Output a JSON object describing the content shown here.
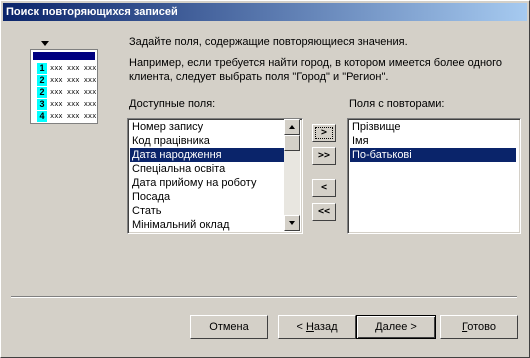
{
  "window": {
    "title": "Поиск повторяющихся записей"
  },
  "illustration": {
    "row_numbers": [
      "1",
      "2",
      "3",
      "4"
    ],
    "cell_pattern": "xxx xxx xxx"
  },
  "intro": {
    "line1": "Задайте поля, содержащие повторяющиеся значения.",
    "line2": "Например, если требуется найти город, в котором имеется более одного",
    "line3": "клиента, следует выбрать поля \"Город\" и \"Регион\"."
  },
  "available": {
    "label": "Доступные поля:",
    "items": [
      "Номер запису",
      "Код працівника",
      "Дата народження",
      "Спеціальна освіта",
      "Дата прийому на роботу",
      "Посада",
      "Стать",
      "Мінімальний оклад"
    ],
    "selected_index": 2
  },
  "selected": {
    "label": "Поля с повторами:",
    "items": [
      "Прізвище",
      "Імя",
      "По-батькові"
    ],
    "selected_index": 2
  },
  "move_buttons": {
    "add": ">",
    "add_all": ">>",
    "remove": "<",
    "remove_all": "<<"
  },
  "buttons": {
    "cancel": "Отмена",
    "back_mnemonic": "Н",
    "back_rest": "азад",
    "back_prefix": "< ",
    "next_mnemonic": "Д",
    "next_rest": "алее >",
    "finish_mnemonic": "Г",
    "finish_rest": "отово"
  }
}
